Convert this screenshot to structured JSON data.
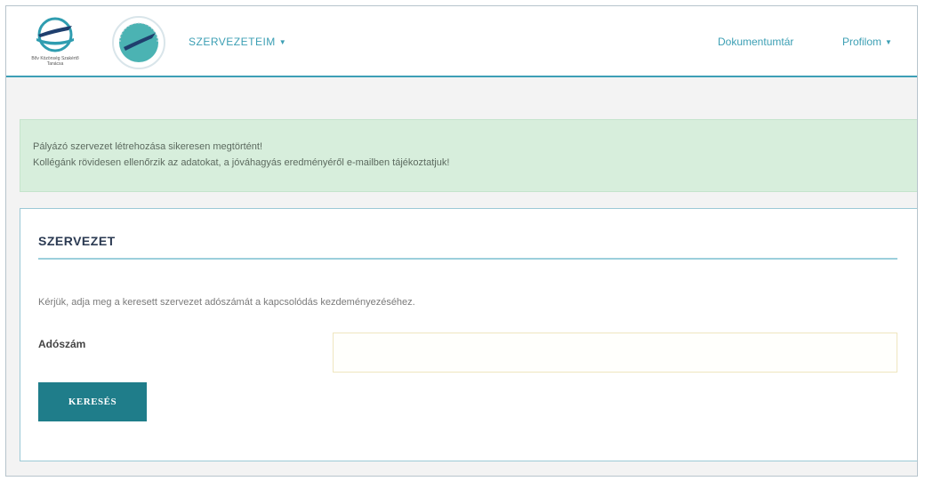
{
  "nav": {
    "logo1_caption": "Bőv Közönség Szakértő Tanácsa",
    "menu_label": "SZERVEZETEIM",
    "documents_label": "Dokumentumtár",
    "profile_label": "Profilom"
  },
  "alert": {
    "line1": "Pályázó szervezet létrehozása sikeresen megtörtént!",
    "line2": "Kollégánk rövidesen ellenőrzik az adatokat, a jóváhagyás eredményéről e-mailben tájékoztatjuk!"
  },
  "panel": {
    "title": "SZERVEZET",
    "help_text": "Kérjük, adja meg a keresett szervezet adószámát a kapcsolódás kezdeményezéséhez.",
    "field_label": "Adószám",
    "field_value": "",
    "search_button": "KERESÉS"
  },
  "colors": {
    "accent": "#3c9fb4",
    "button": "#1f7d8a",
    "alert_bg": "#d7eedc",
    "title": "#2b3a52"
  },
  "icons": {
    "logo1": "bird-over-water-logo",
    "logo2": "bird-round-seal-logo",
    "menu_caret": "caret-down-icon",
    "profile_caret": "caret-down-icon"
  }
}
